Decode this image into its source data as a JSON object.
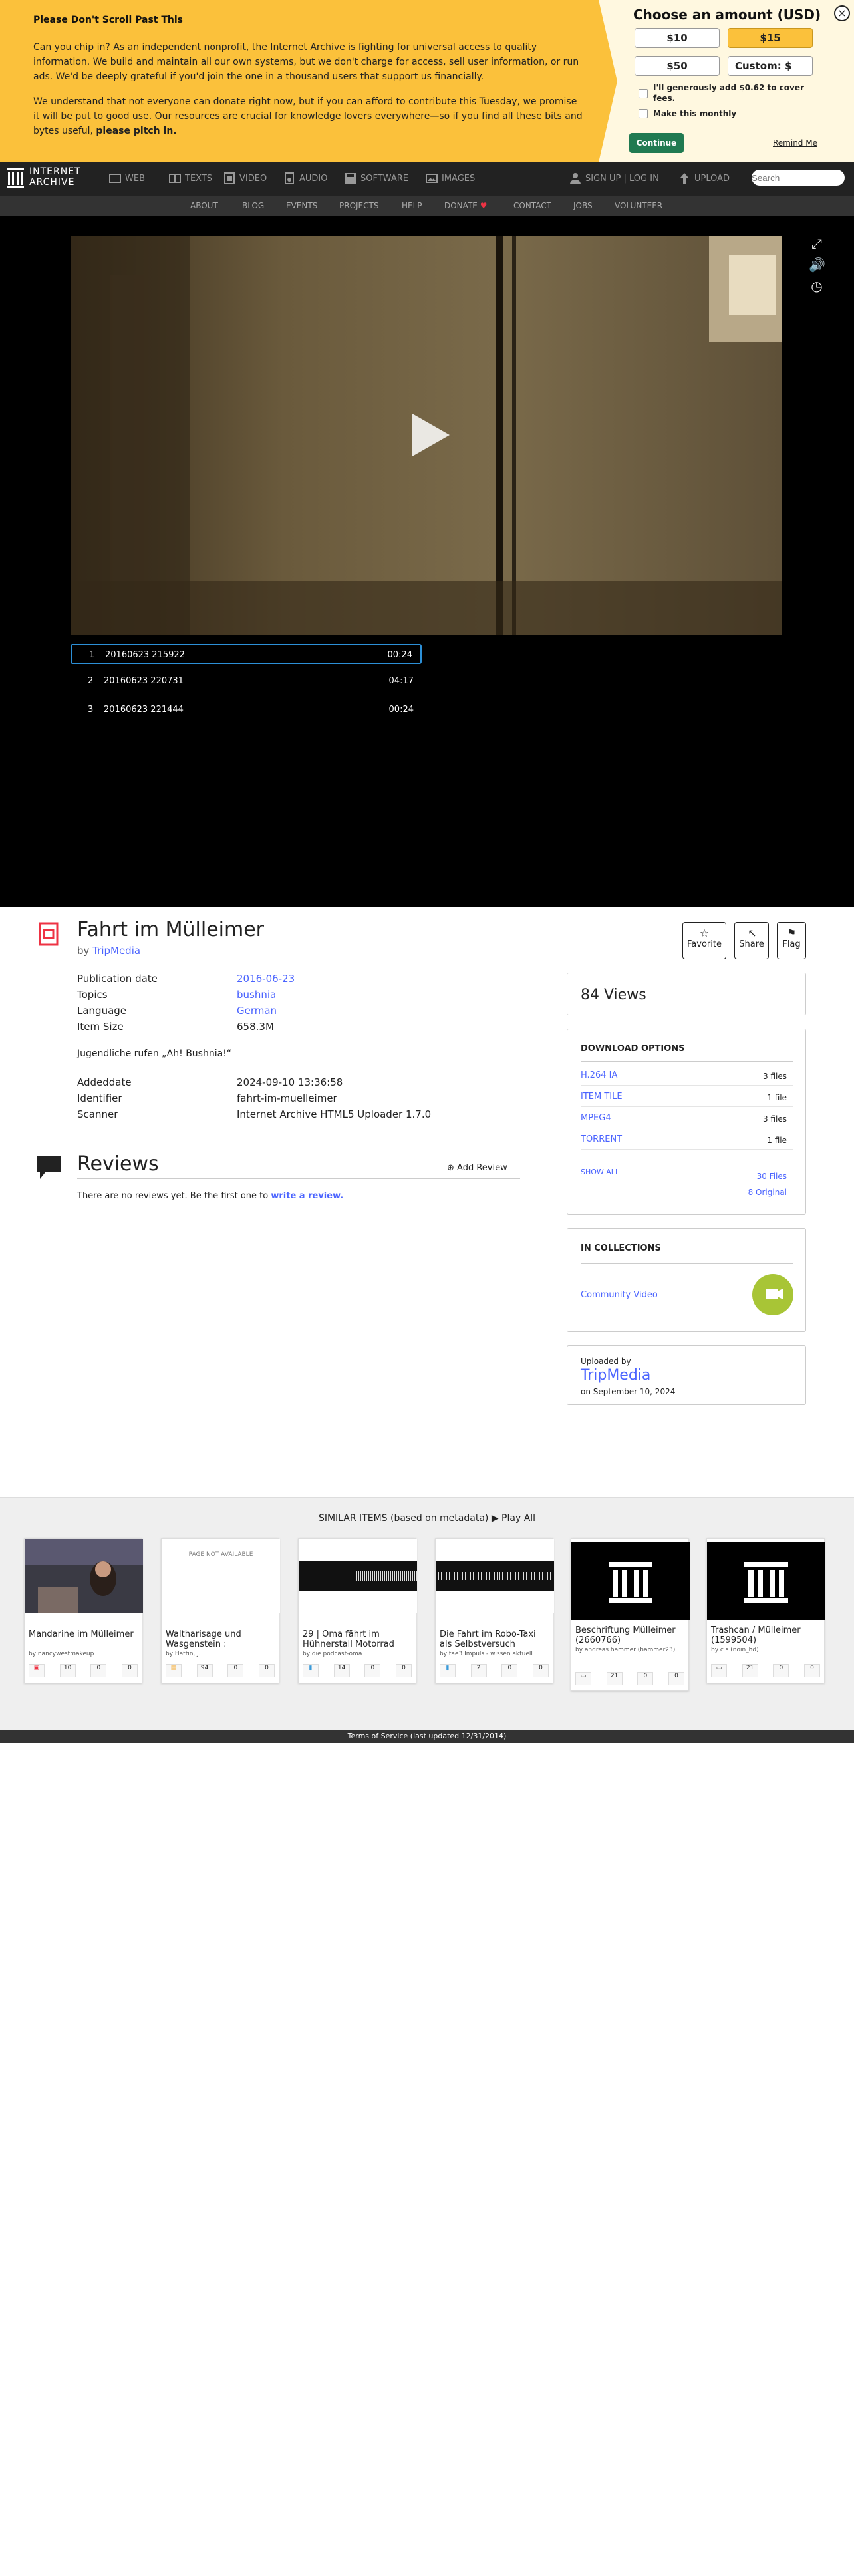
{
  "banner": {
    "title": "Please Don't Scroll Past This",
    "p1": "Can you chip in? As an independent nonprofit, the Internet Archive is fighting for universal access to quality information. We build and maintain all our own systems, but we don't charge for access, sell user information, or run ads. We'd be deeply grateful if you'd join the one in a thousand users that support us financially.",
    "p2": "We understand that not everyone can donate right now, but if you can afford to contribute this Tuesday, we promise it will be put to good use. Our resources are crucial for knowledge lovers everywhere—so if you find all these bits and bytes useful,",
    "p2_bold": "please pitch in.",
    "choose": "Choose an amount (USD)",
    "amounts": [
      "$10",
      "$15",
      "$50",
      "Custom: $"
    ],
    "cover_fees": "I'll generously add $0.62 to cover fees.",
    "monthly": "Make this monthly",
    "continue": "Continue",
    "remind": "Remind Me",
    "close": "×"
  },
  "nav": {
    "logo_line1": "INTERNET",
    "logo_line2": "ARCHIVE",
    "items": [
      "WEB",
      "TEXTS",
      "VIDEO",
      "AUDIO",
      "SOFTWARE",
      "IMAGES"
    ],
    "signup": "SIGN UP | LOG IN",
    "upload": "UPLOAD",
    "search_placeholder": "Search",
    "sub_items": [
      "ABOUT",
      "BLOG",
      "EVENTS",
      "PROJECTS",
      "HELP",
      "DONATE",
      "CONTACT",
      "JOBS",
      "VOLUNTEER"
    ]
  },
  "playlist": [
    {
      "n": "1",
      "title": "20160623 215922",
      "dur": "00:24"
    },
    {
      "n": "2",
      "title": "20160623 220731",
      "dur": "04:17"
    },
    {
      "n": "3",
      "title": "20160623 221444",
      "dur": "00:24"
    }
  ],
  "item": {
    "title": "Fahrt im Mülleimer",
    "by_label": "by",
    "by": "TripMedia",
    "actions": [
      "Favorite",
      "Share",
      "Flag"
    ],
    "meta": [
      {
        "k": "Publication date",
        "v": "2016-06-23",
        "link": true
      },
      {
        "k": "Topics",
        "v": "bushnia",
        "link": true
      },
      {
        "k": "Language",
        "v": "German",
        "link": true
      },
      {
        "k": "Item Size",
        "v": "658.3M",
        "link": false
      }
    ],
    "description": "Jugendliche rufen „Ah! Bushnia!“",
    "meta2": [
      {
        "k": "Addeddate",
        "v": "2024-09-10 13:36:58"
      },
      {
        "k": "Identifier",
        "v": "fahrt-im-muelleimer"
      },
      {
        "k": "Scanner",
        "v": "Internet Archive HTML5 Uploader 1.7.0"
      }
    ],
    "reviews_title": "Reviews",
    "add_review": "Add Review",
    "no_reviews": "There are no reviews yet. Be the first one to",
    "write_review": "write a review."
  },
  "sidebar": {
    "views": "84 Views",
    "download_title": "DOWNLOAD OPTIONS",
    "downloads": [
      {
        "name": "H.264 IA",
        "count": "3 files"
      },
      {
        "name": "ITEM TILE",
        "count": "1 file"
      },
      {
        "name": "MPEG4",
        "count": "3 files"
      },
      {
        "name": "TORRENT",
        "count": "1 file"
      }
    ],
    "show_all": "SHOW ALL",
    "files_30": "30 Files",
    "original_8": "8 Original",
    "collections_title": "IN COLLECTIONS",
    "collection": "Community Video",
    "uploaded_by": "Uploaded by",
    "uploader": "TripMedia",
    "uploaded_on": "on September 10, 2024"
  },
  "similar": {
    "title": "SIMILAR ITEMS (based on metadata)",
    "play_all": "Play All",
    "tiles": [
      {
        "title": "Mandarine im Mülleimer",
        "by": "by nancywestmakeup",
        "stats": [
          "10",
          "0",
          "0"
        ]
      },
      {
        "title": "Waltharisage und Wasgenstein :",
        "by": "by Hattin, J.",
        "stats": [
          "94",
          "0",
          "0"
        ],
        "page": "PAGE NOT AVAILABLE"
      },
      {
        "title": "29 | Oma fährt im Hühnerstall Motorrad",
        "by": "by die podcast-oma",
        "stats": [
          "14",
          "0",
          "0"
        ]
      },
      {
        "title": "Die Fahrt im Robo-Taxi als Selbstversuch",
        "by": "by tae3 Impuls - wissen aktuell",
        "stats": [
          "2",
          "0",
          "0"
        ]
      },
      {
        "title": "Beschriftung Mülleimer (2660766)",
        "by": "by andreas hammer (hammer23)",
        "stats": [
          "21",
          "0",
          "0"
        ]
      },
      {
        "title": "Trashcan / Mülleimer (1599504)",
        "by": "by c s (noin_hd)",
        "stats": [
          "21",
          "0",
          "0"
        ]
      }
    ]
  },
  "footer": "Terms of Service (last updated 12/31/2014)",
  "colors": {
    "banner": "#fbc13b",
    "accent": "#4b64ff",
    "continue": "#207a51",
    "collection": "#a8c536"
  }
}
